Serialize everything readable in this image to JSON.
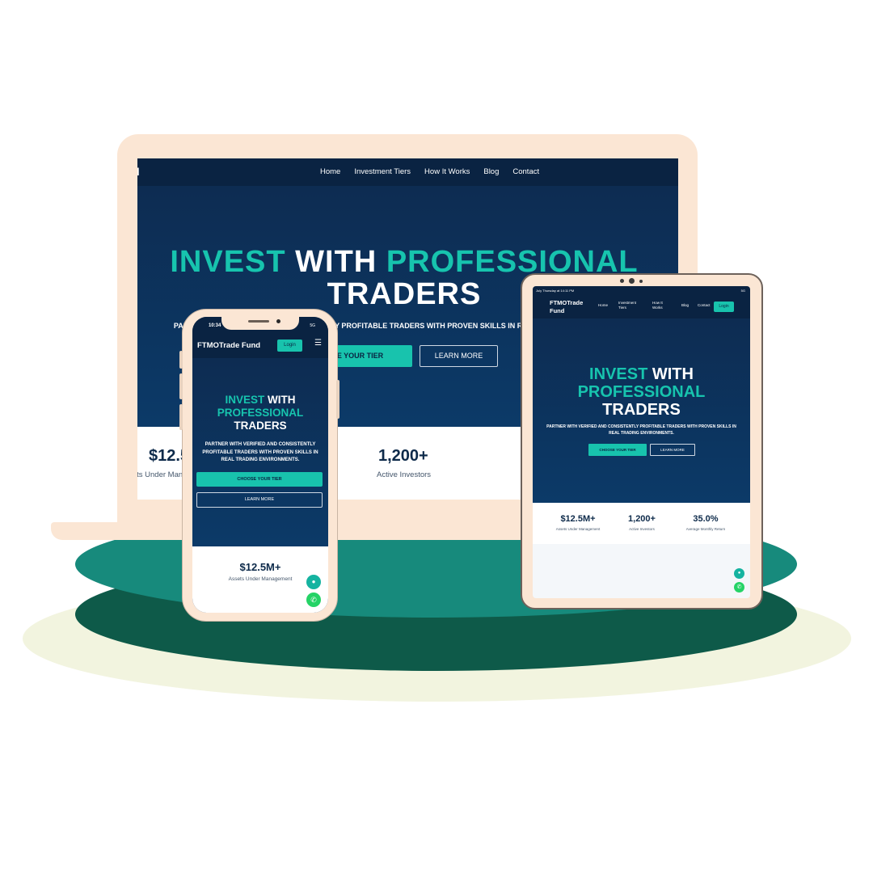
{
  "brand": {
    "name": "FTMOTrade Fund",
    "laptop_name_visible": "e Fund"
  },
  "nav": {
    "items": [
      "Home",
      "Investment Tiers",
      "How It Works",
      "Blog",
      "Contact"
    ],
    "login": "Login"
  },
  "hero": {
    "title_word_1": "INVEST",
    "title_word_2": "WITH",
    "title_word_3": "PROFESSIONAL",
    "title_word_4": "TRADERS",
    "subtitle": "PARTNER WITH VERIFIED AND CONSISTENTLY PROFITABLE TRADERS WITH PROVEN SKILLS IN REAL TRADING ENVIRONMENTS.",
    "primary_button": "CHOOSE YOUR TIER",
    "secondary_button": "LEARN MORE"
  },
  "stats": [
    {
      "value": "$12.5M+",
      "label": "Assets Under Management"
    },
    {
      "value": "1,200+",
      "label": "Active Investors"
    },
    {
      "value": "35.0%",
      "label": "Average Monthly Return"
    }
  ],
  "phone_status": {
    "time": "10:34",
    "signal": "5G"
  },
  "tablet_status": {
    "time": "July Thursday at 14:11 PM",
    "signal": "5G"
  },
  "icons": {
    "chat": "chat-icon",
    "whatsapp": "whatsapp-icon",
    "menu": "hamburger-menu-icon"
  },
  "colors": {
    "accent": "#18c3ad",
    "navy": "#0a2342",
    "podium": "#178a7c",
    "device_frame": "#fbe6d4"
  }
}
